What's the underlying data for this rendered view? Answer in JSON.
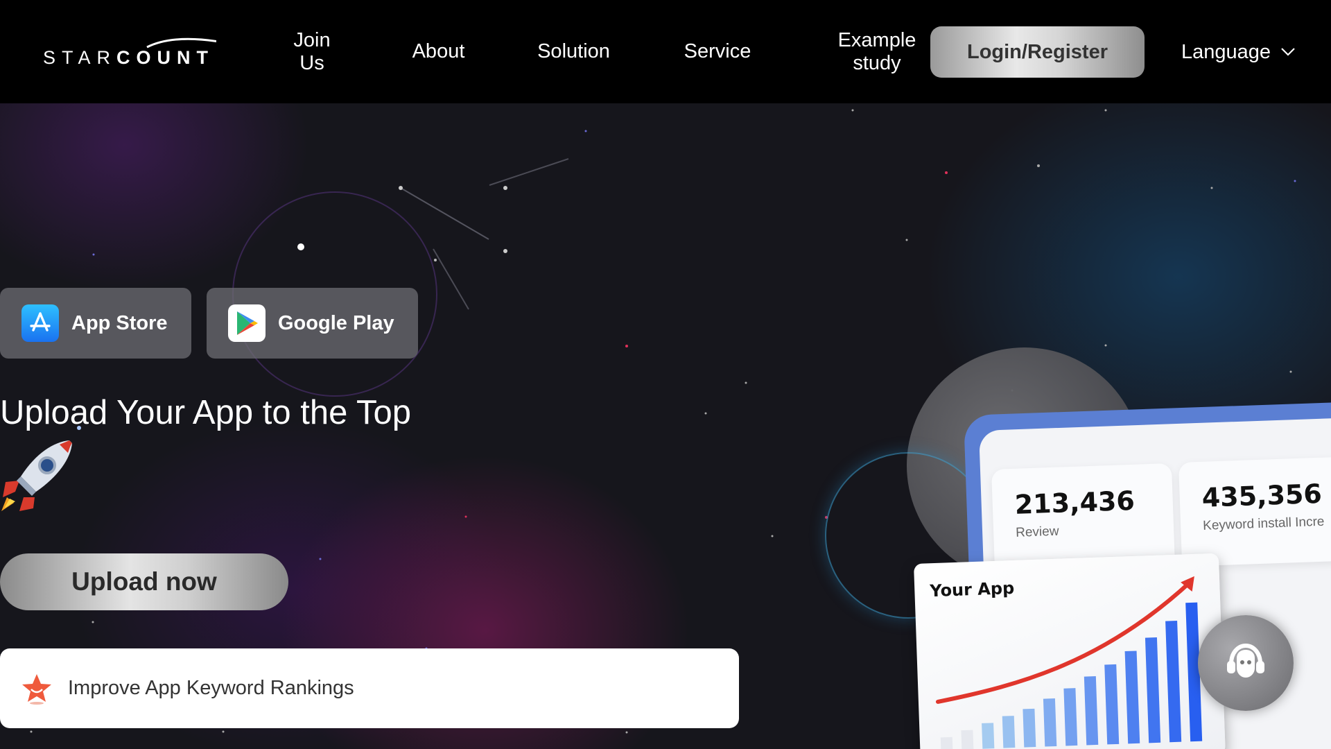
{
  "nav": {
    "logo_text_light": "STAR",
    "logo_text_bold": "COUNT",
    "items": [
      {
        "line1": "Join",
        "line2": "Us"
      },
      {
        "label": "About"
      },
      {
        "label": "Solution"
      },
      {
        "label": "Service"
      },
      {
        "line1": "Example",
        "line2": "study"
      }
    ],
    "login_label": "Login/Register",
    "language_label": "Language"
  },
  "hero": {
    "store_buttons": [
      {
        "label": "App Store",
        "icon": "app-store-icon"
      },
      {
        "label": "Google Play",
        "icon": "google-play-icon"
      }
    ],
    "headline": "Upload Your App to the Top",
    "upload_label": "Upload now",
    "feature_text": "Improve App Keyword Rankings"
  },
  "dashboard": {
    "stats": [
      {
        "value": "213,436",
        "caption": "Review"
      },
      {
        "value": "435,356",
        "caption": "Keyword install Incre"
      }
    ],
    "chart_title": "Your App",
    "bar_levels": [
      0.08,
      0.12,
      0.16,
      0.2,
      0.24,
      0.3,
      0.36,
      0.43,
      0.5,
      0.58,
      0.66,
      0.76,
      0.87
    ]
  },
  "colors": {
    "accent_blue": "#5b7fd3",
    "trend_red": "#e0362c",
    "bar_blue": "#2f6ee0"
  }
}
